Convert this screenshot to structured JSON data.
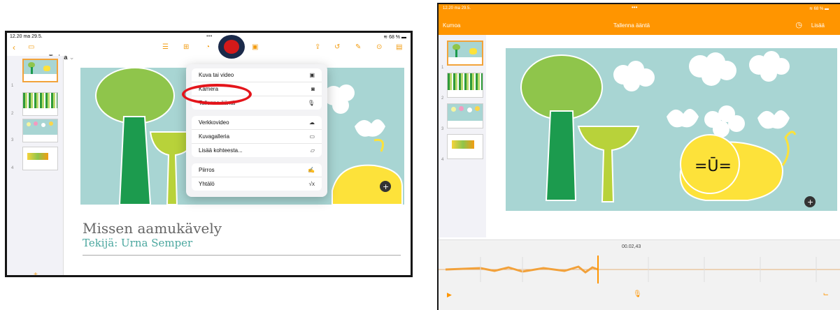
{
  "left": {
    "status": {
      "time": "12.20  ma 29.5.",
      "battery": "68 %"
    },
    "toolbar": {
      "back_icon": "chevron-left-icon",
      "doc_title": "Tarina"
    },
    "slide": {
      "title": "Missen aamukävely",
      "subtitle": "Tekijä: Urna Semper"
    },
    "thumbnails": [
      "1",
      "2",
      "3",
      "4"
    ],
    "insert_menu": {
      "group1": [
        {
          "label": "Kuva tai video",
          "icon": "photo-icon"
        },
        {
          "label": "Kamera",
          "icon": "camera-icon"
        },
        {
          "label": "Tallenna ääntä",
          "icon": "microphone-icon"
        }
      ],
      "group2": [
        {
          "label": "Verkkovideo",
          "icon": "cloud-play-icon"
        },
        {
          "label": "Kuvagalleria",
          "icon": "gallery-icon"
        },
        {
          "label": "Lisää kohteesta...",
          "icon": "folder-icon"
        }
      ],
      "group3": [
        {
          "label": "Piirros",
          "icon": "pencil-icon"
        },
        {
          "label": "Yhtälö",
          "icon": "equation-icon"
        }
      ]
    },
    "plus": "+"
  },
  "right": {
    "status": {
      "time": "12.20  ma 29.5.",
      "battery": "68 %"
    },
    "bar": {
      "cancel": "Kumoa",
      "title": "Tallenna ääntä",
      "add": "Lisää"
    },
    "timer": "00.02,43",
    "thumbnails": [
      "1",
      "2",
      "3",
      "4"
    ]
  },
  "colors": {
    "accent": "#ff9500",
    "highlight": "#e4151b",
    "slide_bg": "#a8d5d3"
  }
}
